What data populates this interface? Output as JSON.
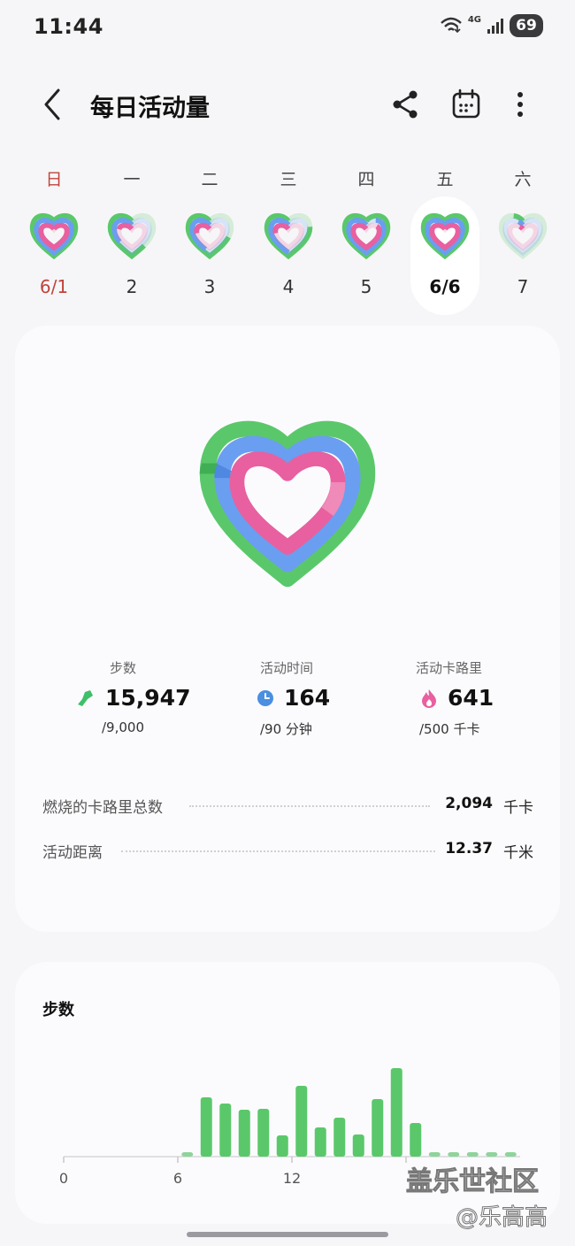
{
  "status_bar": {
    "time": "11:44",
    "network": "4G",
    "battery": "69"
  },
  "header": {
    "title": "每日活动量",
    "icons": [
      "back-icon",
      "share-icon",
      "calendar-icon",
      "more-icon"
    ]
  },
  "week": {
    "days": [
      {
        "name": "日",
        "num": "6/1",
        "selected": false,
        "sunday": true,
        "rings": [
          1,
          1,
          1
        ]
      },
      {
        "name": "一",
        "num": "2",
        "selected": false,
        "sunday": false,
        "rings": [
          0.62,
          0.35,
          0.2
        ]
      },
      {
        "name": "二",
        "num": "3",
        "selected": false,
        "sunday": false,
        "rings": [
          0.7,
          0.45,
          0.25
        ]
      },
      {
        "name": "三",
        "num": "4",
        "selected": false,
        "sunday": false,
        "rings": [
          0.78,
          0.5,
          0.25
        ]
      },
      {
        "name": "四",
        "num": "5",
        "selected": false,
        "sunday": false,
        "rings": [
          1,
          0.9,
          0.85
        ]
      },
      {
        "name": "五",
        "num": "6/6",
        "selected": true,
        "sunday": false,
        "rings": [
          1,
          1,
          1
        ]
      },
      {
        "name": "六",
        "num": "7",
        "selected": false,
        "sunday": false,
        "rings": [
          0.08,
          0.05,
          0.05
        ]
      }
    ]
  },
  "stats": {
    "steps": {
      "label": "步数",
      "value": "15,947",
      "goal": "/9,000"
    },
    "active_time": {
      "label": "活动时间",
      "value": "164",
      "goal": "/90 分钟"
    },
    "active_cal": {
      "label": "活动卡路里",
      "value": "641",
      "goal": "/500 千卡"
    }
  },
  "details": [
    {
      "label": "燃烧的卡路里总数",
      "value": "2,094",
      "unit": "千卡"
    },
    {
      "label": "活动距离",
      "value": "12.37",
      "unit": "千米"
    }
  ],
  "steps_card": {
    "title": "步数",
    "chart_data": {
      "type": "bar",
      "x_ticks": [
        "0",
        "6",
        "12"
      ],
      "values": [
        0,
        0,
        0,
        0,
        0,
        0,
        0.05,
        0.67,
        0.6,
        0.53,
        0.54,
        0.24,
        0.8,
        0.33,
        0.44,
        0.25,
        0.65,
        1.0,
        0.38,
        0.05,
        0.05,
        0.02,
        0.05,
        0.05
      ],
      "color": "#5ac86a",
      "low_color": "#8fd49a"
    }
  },
  "watermark": {
    "line1": "盖乐世社区",
    "line2": "@乐高高"
  },
  "colors": {
    "green": "#5ac86a",
    "blue": "#6a9ef0",
    "pink": "#e8609f",
    "sunday_red": "#c0443b"
  }
}
